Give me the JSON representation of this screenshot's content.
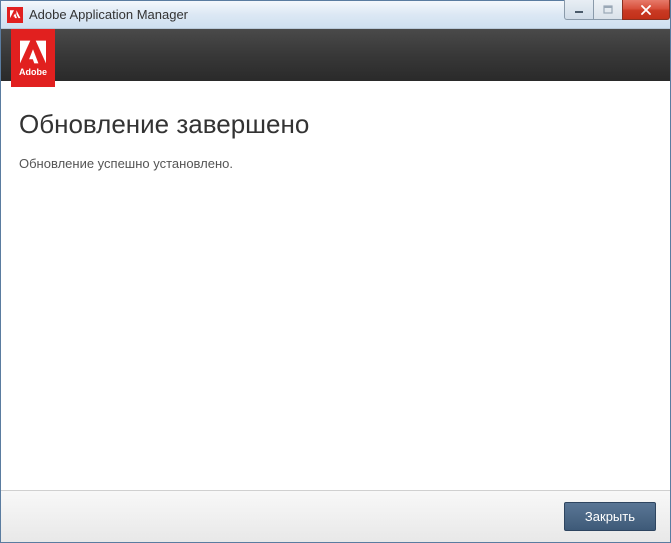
{
  "titlebar": {
    "title": "Adobe Application Manager"
  },
  "header": {
    "logo_text": "Adobe"
  },
  "content": {
    "heading": "Обновление завершено",
    "message": "Обновление успешно установлено."
  },
  "footer": {
    "close_label": "Закрыть"
  }
}
